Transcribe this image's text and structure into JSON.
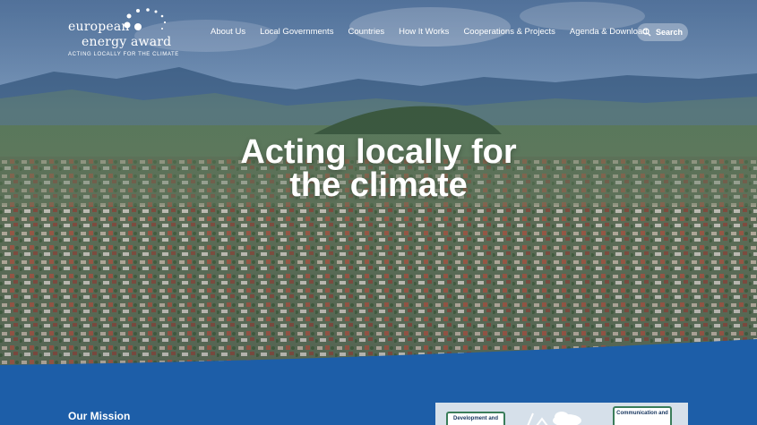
{
  "logo": {
    "line1": "european",
    "line2": "energy award",
    "tagline": "ACTING LOCALLY FOR THE CLIMATE"
  },
  "nav": {
    "items": [
      {
        "label": "About Us"
      },
      {
        "label": "Local Governments"
      },
      {
        "label": "Countries"
      },
      {
        "label": "How It Works"
      },
      {
        "label": "Cooperations & Projects"
      },
      {
        "label": "Agenda & Download"
      }
    ]
  },
  "search": {
    "label": "Search",
    "icon": "search-icon"
  },
  "hero": {
    "headline_line1": "Acting locally for",
    "headline_line2": "the climate"
  },
  "mission": {
    "heading": "Our Mission"
  },
  "infographic": {
    "box1": "Development and",
    "box2": "Communication and"
  },
  "colors": {
    "accent": "#1d5ea8",
    "text_on_dark": "#ffffff"
  }
}
